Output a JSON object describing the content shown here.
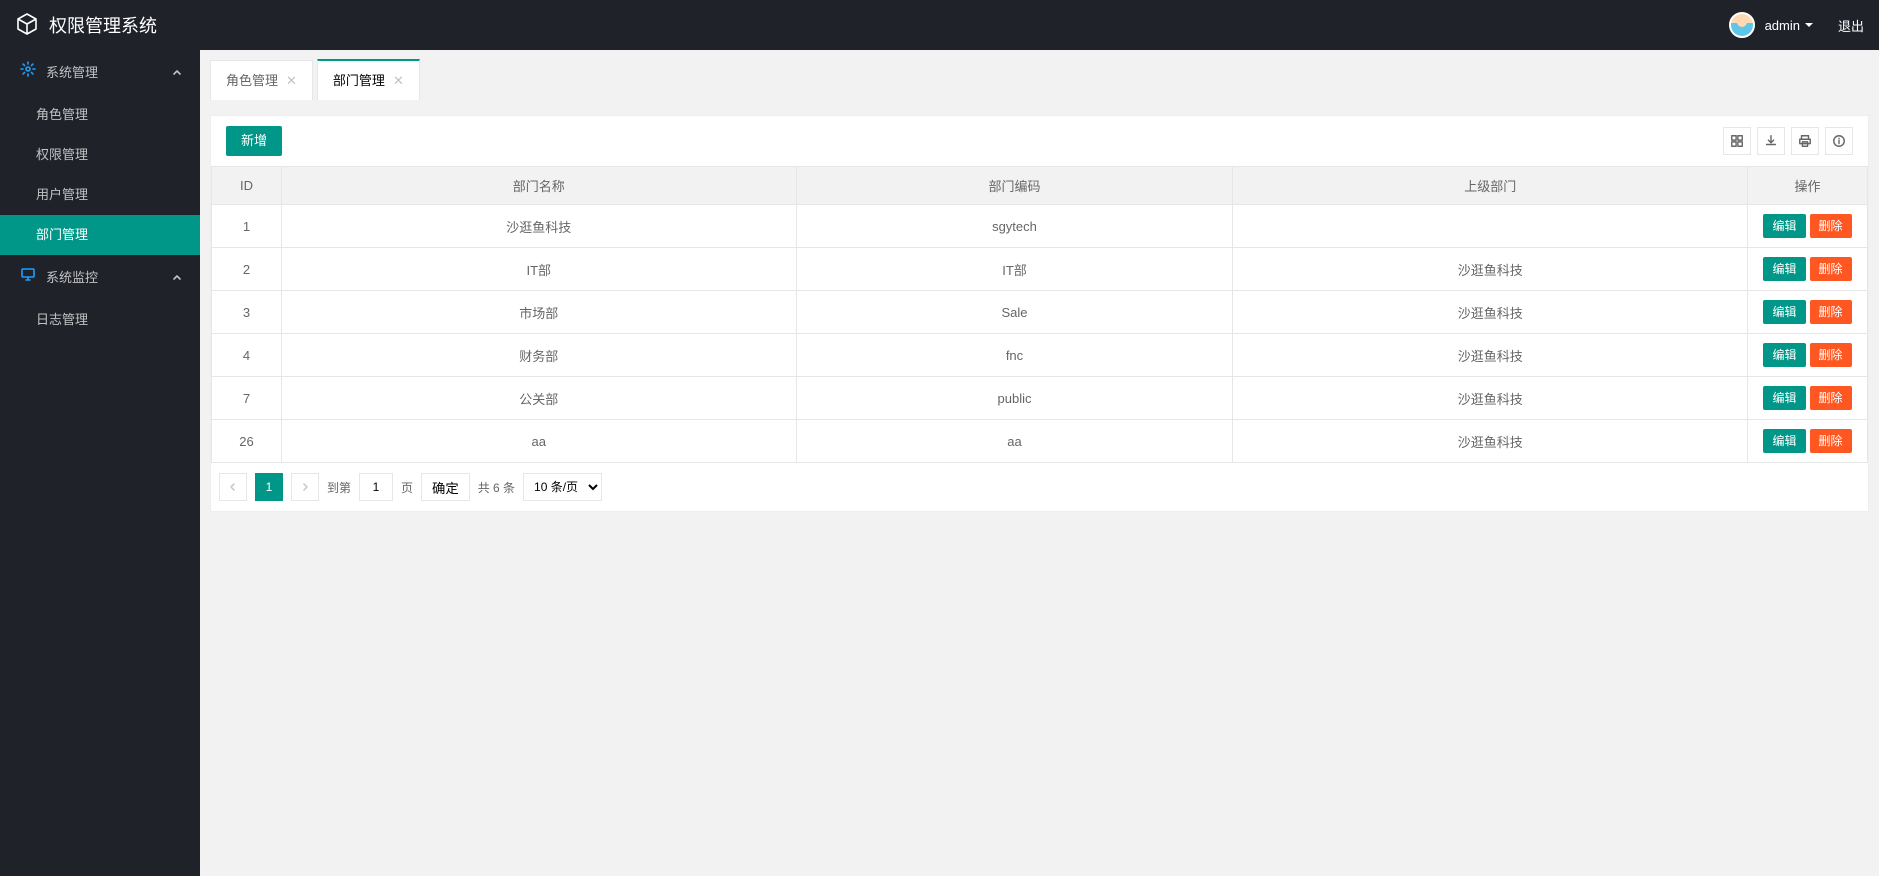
{
  "header": {
    "app_title": "权限管理系统",
    "username": "admin",
    "logout": "退出"
  },
  "sidebar": {
    "groups": [
      {
        "label": "系统管理",
        "icon": "gear-icon",
        "items": [
          {
            "label": "角色管理",
            "active": false
          },
          {
            "label": "权限管理",
            "active": false
          },
          {
            "label": "用户管理",
            "active": false
          },
          {
            "label": "部门管理",
            "active": true
          }
        ]
      },
      {
        "label": "系统监控",
        "icon": "monitor-icon",
        "items": [
          {
            "label": "日志管理",
            "active": false
          }
        ]
      }
    ]
  },
  "tabs": [
    {
      "label": "角色管理",
      "active": false,
      "closable": true
    },
    {
      "label": "部门管理",
      "active": true,
      "closable": true
    }
  ],
  "toolbar": {
    "add_label": "新增"
  },
  "table": {
    "columns": {
      "id": "ID",
      "name": "部门名称",
      "code": "部门编码",
      "parent": "上级部门",
      "ops": "操作"
    },
    "edit_label": "编辑",
    "delete_label": "删除",
    "rows": [
      {
        "id": "1",
        "name": "沙逛鱼科技",
        "code": "sgytech",
        "parent": ""
      },
      {
        "id": "2",
        "name": "IT部",
        "code": "IT部",
        "parent": "沙逛鱼科技"
      },
      {
        "id": "3",
        "name": "市场部",
        "code": "Sale",
        "parent": "沙逛鱼科技"
      },
      {
        "id": "4",
        "name": "财务部",
        "code": "fnc",
        "parent": "沙逛鱼科技"
      },
      {
        "id": "7",
        "name": "公关部",
        "code": "public",
        "parent": "沙逛鱼科技"
      },
      {
        "id": "26",
        "name": "aa",
        "code": "aa",
        "parent": "沙逛鱼科技"
      }
    ]
  },
  "pager": {
    "current": "1",
    "goto_prefix": "到第",
    "goto_value": "1",
    "goto_suffix": "页",
    "confirm": "确定",
    "total_text": "共 6 条",
    "page_size": "10 条/页"
  }
}
